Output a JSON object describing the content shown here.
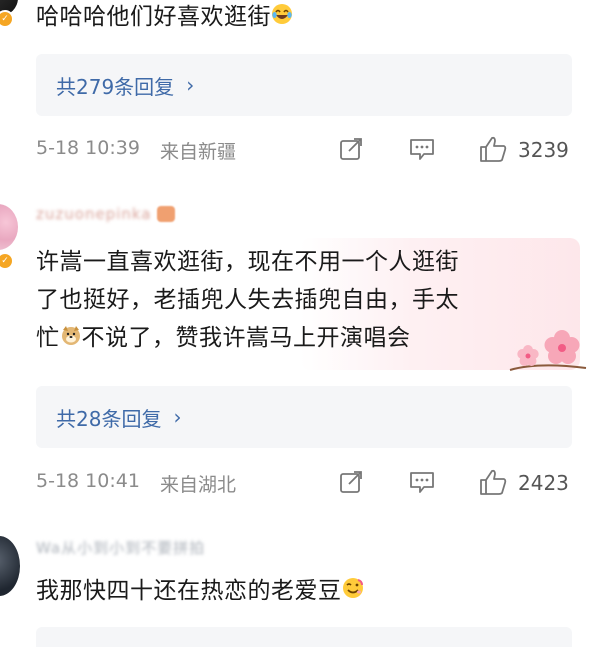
{
  "comments": [
    {
      "text": "哈哈哈他们好喜欢逛街",
      "reply": "共279条回复",
      "date": "5-18 10:39",
      "location": "来自新疆",
      "likes": "3239"
    },
    {
      "username": "zuzuonepinka",
      "lines": [
        "许嵩一直喜欢逛街，现在不用一个人逛街",
        "了也挺好，老插兜人失去插兜自由，手太",
        "忙",
        "不说了，赞我许嵩马上开演唱会"
      ],
      "reply": "共28条回复",
      "date": "5-18 10:41",
      "location": "来自湖北",
      "likes": "2423"
    },
    {
      "username": "Wa从小到小到不要拼拍",
      "text": "我那快四十还在热恋的老爱豆"
    }
  ],
  "icons": {
    "laugh": "laughing-tears-emoji",
    "doge": "doge-emoji",
    "wink": "wink-emoji",
    "share": "share-icon",
    "comment": "comment-icon",
    "like": "thumbs-up-icon",
    "flowers": "peach-blossom-decoration"
  },
  "colors": {
    "link": "#3f6aa8",
    "meta": "#8b8b8b",
    "badge": "#f5a623"
  }
}
